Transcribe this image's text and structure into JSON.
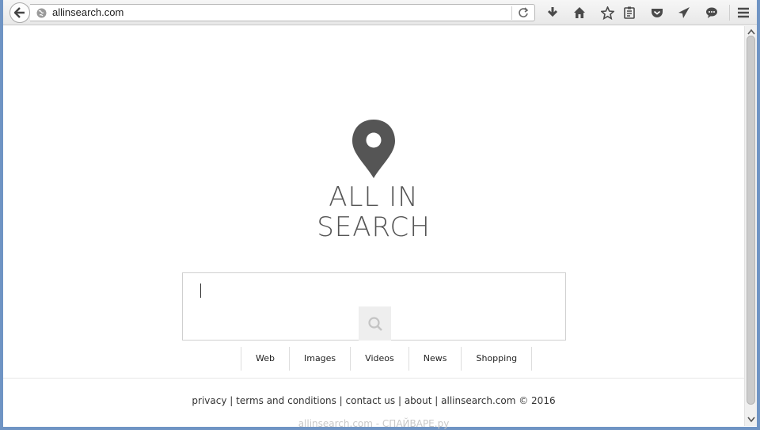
{
  "browser": {
    "url": "allinsearch.com",
    "icons": [
      "back-arrow-icon",
      "globe-icon",
      "reload-icon",
      "download-icon",
      "home-icon",
      "bookmark-star-icon",
      "reading-list-icon",
      "pocket-icon",
      "send-icon",
      "chat-icon",
      "hamburger-menu-icon"
    ]
  },
  "logo": {
    "line1": "ALL IN",
    "line2": "SEARCH",
    "color": "#555555"
  },
  "search": {
    "value": "",
    "button_icon": "magnifier-icon"
  },
  "tabs": [
    {
      "label": "Web"
    },
    {
      "label": "Images"
    },
    {
      "label": "Videos"
    },
    {
      "label": "News"
    },
    {
      "label": "Shopping"
    }
  ],
  "footer": {
    "privacy": "privacy",
    "terms": "terms and conditions",
    "contact": "contact us",
    "about": "about",
    "copyright": "allinsearch.com © 2016",
    "sep": "|"
  },
  "watermark": "allinsearch.com - СПАЙВАРЕ.ру"
}
